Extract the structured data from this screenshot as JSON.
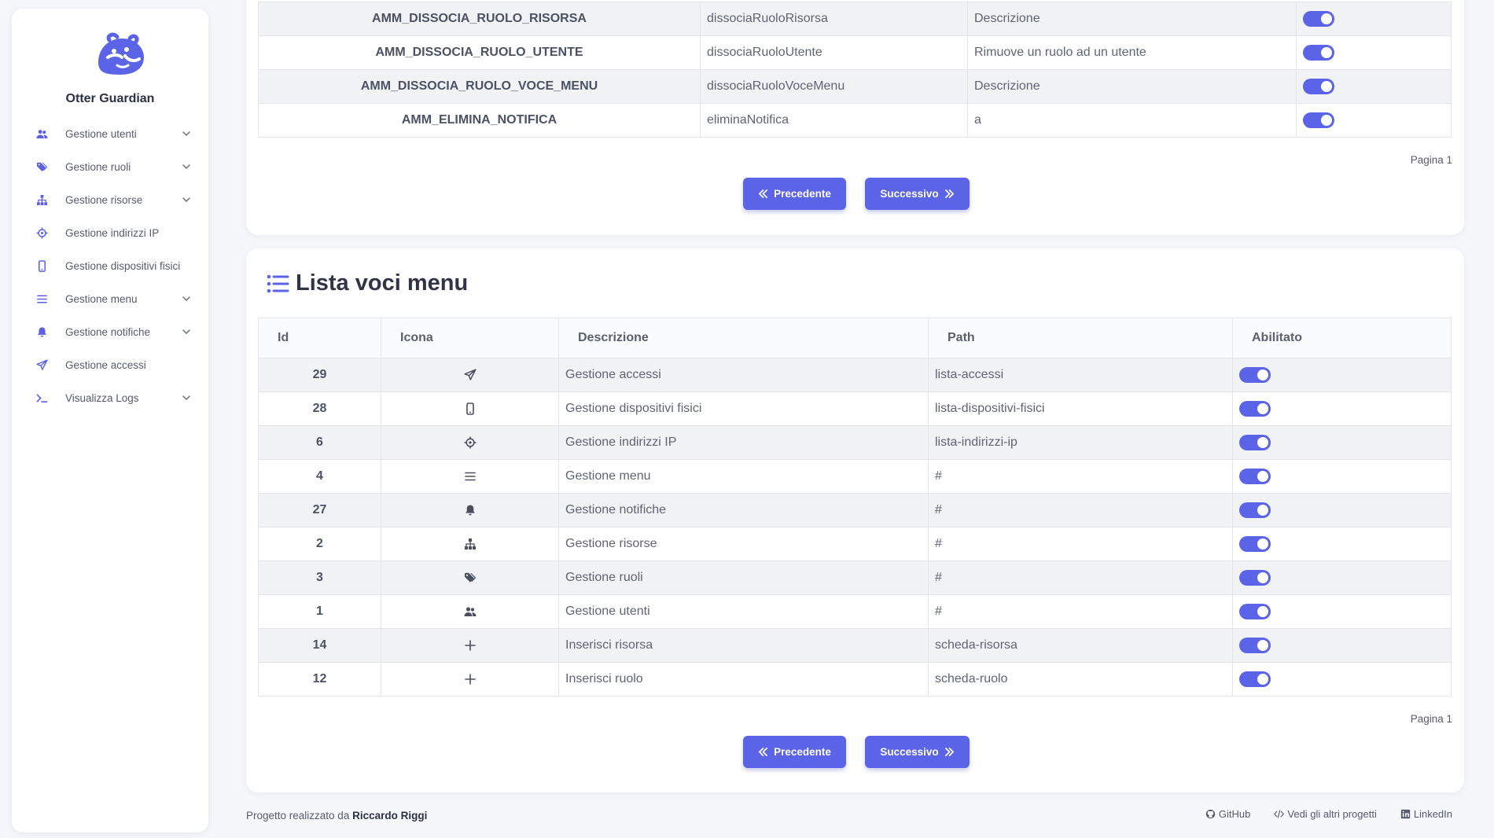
{
  "app": {
    "name": "Otter Guardian"
  },
  "sidebar": {
    "items": [
      {
        "label": "Gestione utenti",
        "icon": "users-icon",
        "expandable": true
      },
      {
        "label": "Gestione ruoli",
        "icon": "tags-icon",
        "expandable": true
      },
      {
        "label": "Gestione risorse",
        "icon": "sitemap-icon",
        "expandable": true
      },
      {
        "label": "Gestione indirizzi IP",
        "icon": "crosshairs-icon",
        "expandable": false
      },
      {
        "label": "Gestione dispositivi fisici",
        "icon": "mobile-icon",
        "expandable": false
      },
      {
        "label": "Gestione menu",
        "icon": "bars-icon",
        "expandable": true
      },
      {
        "label": "Gestione notifiche",
        "icon": "bell-icon",
        "expandable": true
      },
      {
        "label": "Gestione accessi",
        "icon": "paper-plane-icon",
        "expandable": false
      },
      {
        "label": "Visualizza Logs",
        "icon": "terminal-icon",
        "expandable": true
      }
    ]
  },
  "top_table": {
    "rows": [
      {
        "code": "AMM_DISSOCIA_RUOLO_RISORSA",
        "function": "dissociaRuoloRisorsa",
        "description": "Descrizione",
        "enabled": true
      },
      {
        "code": "AMM_DISSOCIA_RUOLO_UTENTE",
        "function": "dissociaRuoloUtente",
        "description": "Rimuove un ruolo ad un utente",
        "enabled": true
      },
      {
        "code": "AMM_DISSOCIA_RUOLO_VOCE_MENU",
        "function": "dissociaRuoloVoceMenu",
        "description": "Descrizione",
        "enabled": true
      },
      {
        "code": "AMM_ELIMINA_NOTIFICA",
        "function": "eliminaNotifica",
        "description": "a",
        "enabled": true
      }
    ],
    "page_label": "Pagina 1",
    "prev_label": "Precedente",
    "next_label": "Successivo"
  },
  "menu_list": {
    "title": "Lista voci menu",
    "columns": [
      "Id",
      "Icona",
      "Descrizione",
      "Path",
      "Abilitato"
    ],
    "rows": [
      {
        "id": "29",
        "icon": "paper-plane-icon",
        "description": "Gestione accessi",
        "path": "lista-accessi",
        "enabled": true
      },
      {
        "id": "28",
        "icon": "mobile-icon",
        "description": "Gestione dispositivi fisici",
        "path": "lista-dispositivi-fisici",
        "enabled": true
      },
      {
        "id": "6",
        "icon": "crosshairs-icon",
        "description": "Gestione indirizzi IP",
        "path": "lista-indirizzi-ip",
        "enabled": true
      },
      {
        "id": "4",
        "icon": "bars-icon",
        "description": "Gestione menu",
        "path": "#",
        "enabled": true
      },
      {
        "id": "27",
        "icon": "bell-icon",
        "description": "Gestione notifiche",
        "path": "#",
        "enabled": true
      },
      {
        "id": "2",
        "icon": "sitemap-icon",
        "description": "Gestione risorse",
        "path": "#",
        "enabled": true
      },
      {
        "id": "3",
        "icon": "tags-icon",
        "description": "Gestione ruoli",
        "path": "#",
        "enabled": true
      },
      {
        "id": "1",
        "icon": "users-icon",
        "description": "Gestione utenti",
        "path": "#",
        "enabled": true
      },
      {
        "id": "14",
        "icon": "plus-icon",
        "description": "Inserisci risorsa",
        "path": "scheda-risorsa",
        "enabled": true
      },
      {
        "id": "12",
        "icon": "plus-icon",
        "description": "Inserisci ruolo",
        "path": "scheda-ruolo",
        "enabled": true
      }
    ],
    "page_label": "Pagina 1",
    "prev_label": "Precedente",
    "next_label": "Successivo"
  },
  "footer": {
    "prefix": "Progetto realizzato da",
    "author": "Riccardo Riggi",
    "links": [
      {
        "label": "GitHub",
        "icon": "github-icon"
      },
      {
        "label": "Vedi gli altri progetti",
        "icon": "code-icon"
      },
      {
        "label": "LinkedIn",
        "icon": "linkedin-icon"
      }
    ]
  },
  "colors": {
    "accent": "#5b63e6",
    "background": "#f6f7fb"
  }
}
